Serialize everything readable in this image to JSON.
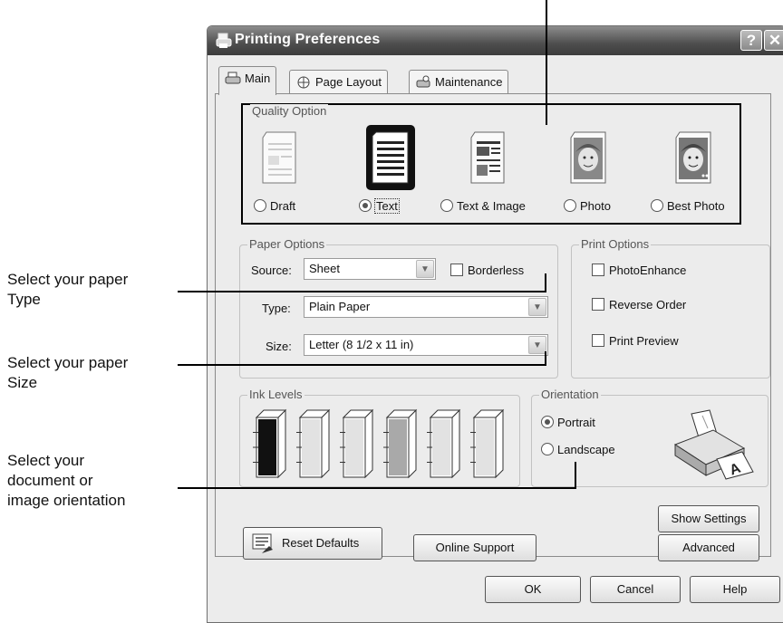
{
  "callouts": {
    "paper_type": "Select your paper\nType",
    "paper_size": "Select your paper\nSize",
    "orientation": "Select your\ndocument or\nimage orientation"
  },
  "window": {
    "title": "Printing Preferences",
    "help_button": "?",
    "close_button": "✕"
  },
  "tabs": [
    {
      "label": "Main",
      "active": true
    },
    {
      "label": "Page Layout",
      "active": false
    },
    {
      "label": "Maintenance",
      "active": false
    }
  ],
  "quality_option": {
    "legend": "Quality Option",
    "options": [
      {
        "label": "Draft",
        "selected": false
      },
      {
        "label": "Text",
        "selected": true
      },
      {
        "label": "Text & Image",
        "selected": false
      },
      {
        "label": "Photo",
        "selected": false
      },
      {
        "label": "Best Photo",
        "selected": false
      }
    ]
  },
  "paper_options": {
    "legend": "Paper Options",
    "source_label": "Source:",
    "source_value": "Sheet",
    "borderless_label": "Borderless",
    "borderless_checked": false,
    "type_label": "Type:",
    "type_value": "Plain Paper",
    "size_label": "Size:",
    "size_value": "Letter (8 1/2 x 11 in)"
  },
  "print_options": {
    "legend": "Print Options",
    "items": [
      {
        "label": "PhotoEnhance",
        "checked": false
      },
      {
        "label": "Reverse Order",
        "checked": false
      },
      {
        "label": "Print Preview",
        "checked": false
      }
    ]
  },
  "ink_levels": {
    "legend": "Ink Levels",
    "cartridges": [
      {
        "color": "#111111",
        "level": 1.0
      },
      {
        "color": "#e2e2e2",
        "level": 1.0
      },
      {
        "color": "#e2e2e2",
        "level": 1.0
      },
      {
        "color": "#a9a9a9",
        "level": 1.0
      },
      {
        "color": "#e2e2e2",
        "level": 1.0
      },
      {
        "color": "#e2e2e2",
        "level": 1.0
      }
    ]
  },
  "orientation": {
    "legend": "Orientation",
    "portrait_label": "Portrait",
    "landscape_label": "Landscape",
    "selected": "Portrait"
  },
  "buttons": {
    "show_settings": "Show Settings",
    "reset_defaults": "Reset Defaults",
    "online_support": "Online Support",
    "advanced": "Advanced",
    "ok": "OK",
    "cancel": "Cancel",
    "help": "Help"
  }
}
